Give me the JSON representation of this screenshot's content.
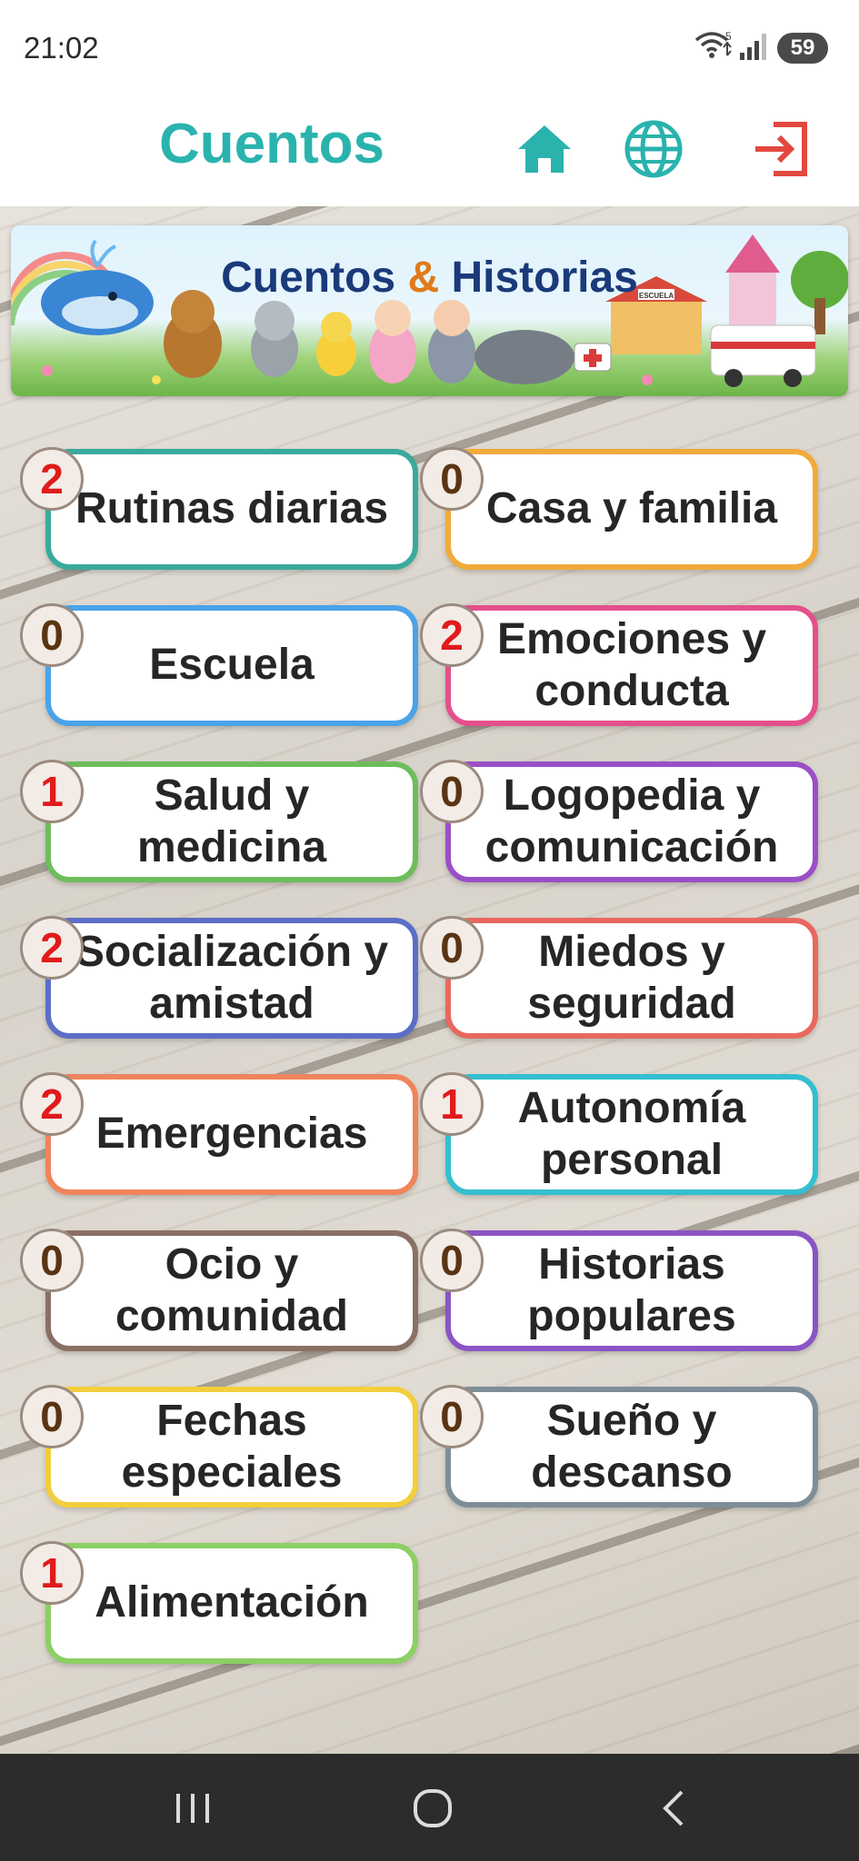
{
  "status_bar": {
    "time": "21:02",
    "battery": "59",
    "wifi_badge": "5"
  },
  "header": {
    "title": "Cuentos",
    "icons": [
      "home-icon",
      "globe-icon",
      "logout-icon"
    ],
    "accent_color": "#2ab3ad",
    "logout_color": "#e2483f"
  },
  "banner": {
    "title_part1": "Cuentos",
    "title_amp": "&",
    "title_part2": "Historias",
    "school_sign": "ESCUELA"
  },
  "categories": [
    {
      "label": "Rutinas diarias",
      "count": "2",
      "color": "#3aaa9c"
    },
    {
      "label": "Casa y familia",
      "count": "0",
      "color": "#f2aa3a"
    },
    {
      "label": "Escuela",
      "count": "0",
      "color": "#4aa3e8"
    },
    {
      "label": "Emociones y conducta",
      "count": "2",
      "color": "#e4508a"
    },
    {
      "label": "Salud y medicina",
      "count": "1",
      "color": "#6dbd5c"
    },
    {
      "label": "Logopedia y comunicación",
      "count": "0",
      "color": "#9b4fc7"
    },
    {
      "label": "Socialización y amistad",
      "count": "2",
      "color": "#5b6ec8"
    },
    {
      "label": "Miedos y seguridad",
      "count": "0",
      "color": "#e8685e"
    },
    {
      "label": "Emergencias",
      "count": "2",
      "color": "#f0845a"
    },
    {
      "label": "Autonomía personal",
      "count": "1",
      "color": "#33bfd0"
    },
    {
      "label": "Ocio y comunidad",
      "count": "0",
      "color": "#8a7064"
    },
    {
      "label": "Historias populares",
      "count": "0",
      "color": "#8a55c4"
    },
    {
      "label": "Fechas especiales",
      "count": "0",
      "color": "#f3ce3c"
    },
    {
      "label": "Sueño y descanso",
      "count": "0",
      "color": "#7d8e99"
    },
    {
      "label": "Alimentación",
      "count": "1",
      "color": "#8ccf62"
    }
  ],
  "navbar": {
    "icons": [
      "recent-apps-icon",
      "home-circle-icon",
      "back-icon"
    ]
  }
}
